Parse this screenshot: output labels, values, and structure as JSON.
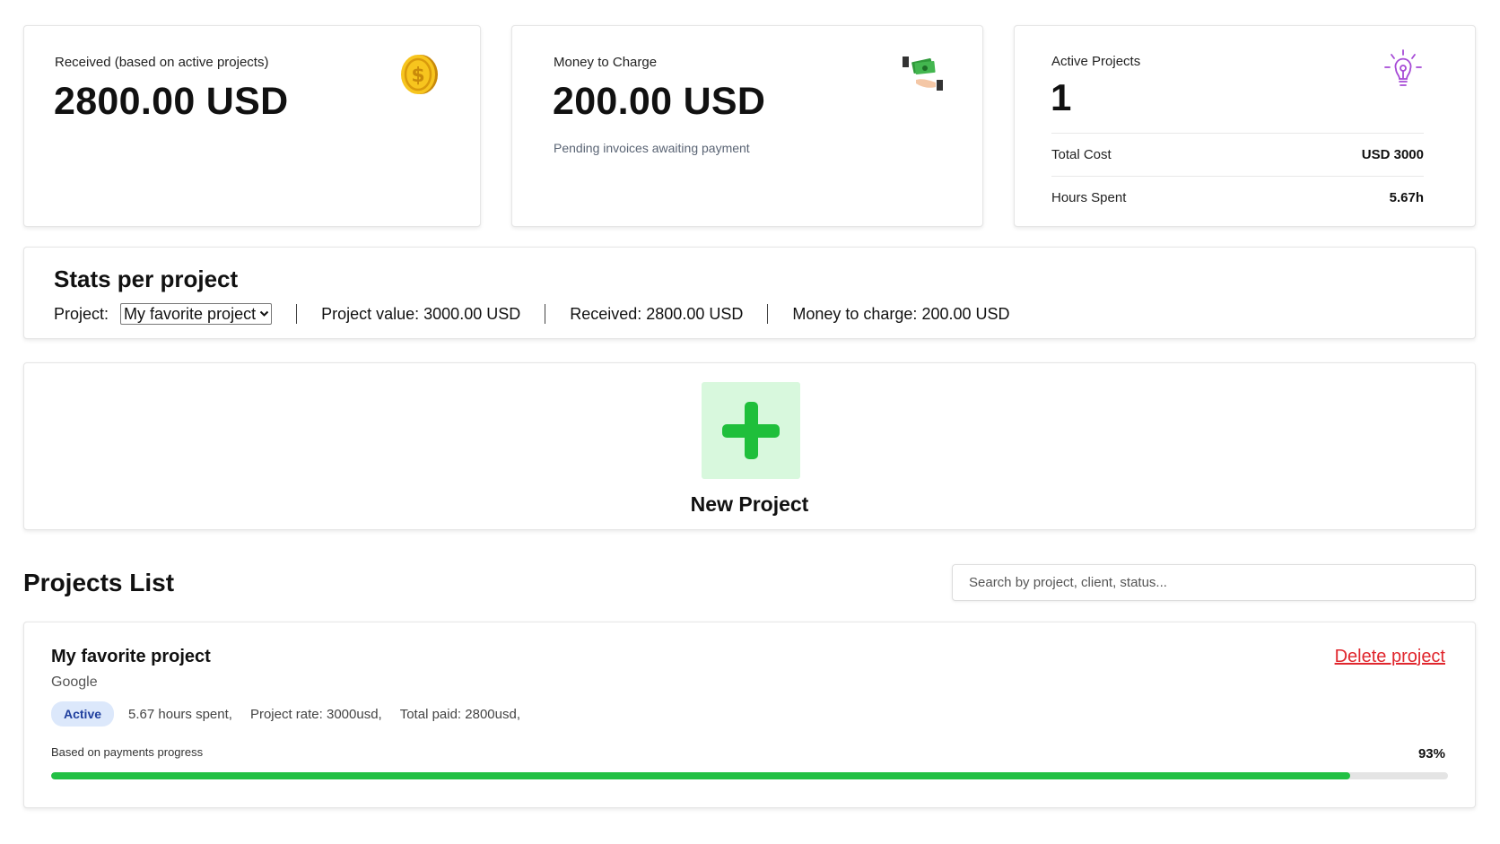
{
  "summary": {
    "received": {
      "label": "Received (based on active projects)",
      "value": "2800.00 USD",
      "icon": "coin-icon"
    },
    "money_to_charge": {
      "label": "Money to Charge",
      "value": "200.00 USD",
      "subtitle": "Pending invoices awaiting payment",
      "icon": "money-hand-icon"
    },
    "active_projects": {
      "label": "Active Projects",
      "value": "1",
      "icon": "lightbulb-icon",
      "total_cost_label": "Total Cost",
      "total_cost_value": "USD 3000",
      "hours_spent_label": "Hours Spent",
      "hours_spent_value": "5.67h"
    }
  },
  "stats": {
    "title": "Stats per project",
    "project_label": "Project:",
    "selected_project": "My favorite project",
    "project_value": "Project value: 3000.00 USD",
    "received": "Received: 2800.00 USD",
    "money_to_charge": "Money to charge: 200.00 USD"
  },
  "new_project": {
    "label": "New Project",
    "icon": "plus-icon"
  },
  "projects_list": {
    "title": "Projects List",
    "search_placeholder": "Search by project, client, status...",
    "items": [
      {
        "name": "My favorite project",
        "client": "Google",
        "status": "Active",
        "hours": "5.67 hours spent,",
        "rate": "Project rate: 3000usd,",
        "paid": "Total paid: 2800usd,",
        "delete_label": "Delete project",
        "progress_label": "Based on payments progress",
        "progress_text": "93%",
        "progress_fraction": 0.93
      }
    ]
  },
  "colors": {
    "accent_green": "#22c044",
    "delete_red": "#e0262d",
    "badge_bg": "#dce8fb",
    "badge_text": "#1f3f9e"
  }
}
